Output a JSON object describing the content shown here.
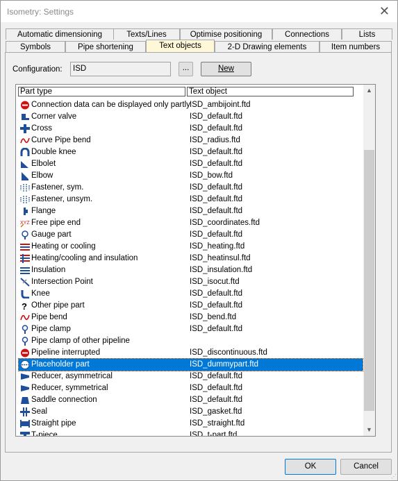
{
  "window": {
    "title": "Isometry: Settings"
  },
  "tabs_back": [
    "Automatic dimensioning",
    "Texts/Lines",
    "Optimise positioning",
    "Connections",
    "Lists"
  ],
  "tabs_front": [
    "Symbols",
    "Pipe shortening",
    "Text objects",
    "2-D Drawing elements",
    "Item numbers"
  ],
  "active_tab": "Text objects",
  "config": {
    "label": "Configuration:",
    "value": "ISD",
    "browse_label": "...",
    "new_label": "New"
  },
  "list": {
    "columns": [
      "Part type",
      "Text object"
    ],
    "rows": [
      {
        "icon": "no-entry-icon",
        "part": "Connection data can be displayed only partly",
        "text": "ISD_ambijoint.ftd"
      },
      {
        "icon": "corner-valve-icon",
        "part": "Corner valve",
        "text": "ISD_default.ftd"
      },
      {
        "icon": "cross-icon",
        "part": "Cross",
        "text": "ISD_default.ftd"
      },
      {
        "icon": "curve-bend-icon",
        "part": "Curve Pipe bend",
        "text": "ISD_radius.ftd"
      },
      {
        "icon": "double-knee-icon",
        "part": "Double knee",
        "text": "ISD_default.ftd"
      },
      {
        "icon": "elbolet-icon",
        "part": "Elbolet",
        "text": "ISD_default.ftd"
      },
      {
        "icon": "elbow-icon",
        "part": "Elbow",
        "text": "ISD_bow.ftd"
      },
      {
        "icon": "fastener-icon",
        "part": "Fastener, sym.",
        "text": "ISD_default.ftd"
      },
      {
        "icon": "fastener-icon",
        "part": "Fastener, unsym.",
        "text": "ISD_default.ftd"
      },
      {
        "icon": "flange-icon",
        "part": "Flange",
        "text": "ISD_default.ftd"
      },
      {
        "icon": "pipe-end-icon",
        "part": "Free pipe end",
        "text": "ISD_coordinates.ftd"
      },
      {
        "icon": "gauge-icon",
        "part": "Gauge part",
        "text": "ISD_default.ftd"
      },
      {
        "icon": "heating-icon",
        "part": "Heating or cooling",
        "text": "ISD_heating.ftd"
      },
      {
        "icon": "heating-insul-icon",
        "part": "Heating/cooling and insulation",
        "text": "ISD_heatinsul.ftd"
      },
      {
        "icon": "insulation-icon",
        "part": "Insulation",
        "text": "ISD_insulation.ftd"
      },
      {
        "icon": "intersection-icon",
        "part": "Intersection Point",
        "text": "ISD_isocut.ftd"
      },
      {
        "icon": "knee-icon",
        "part": "Knee",
        "text": "ISD_default.ftd"
      },
      {
        "icon": "question-icon",
        "part": "Other pipe part",
        "text": "ISD_default.ftd"
      },
      {
        "icon": "pipe-bend-icon",
        "part": "Pipe bend",
        "text": "ISD_bend.ftd"
      },
      {
        "icon": "pipe-clamp-icon",
        "part": "Pipe clamp",
        "text": "ISD_default.ftd"
      },
      {
        "icon": "pipe-clamp-icon",
        "part": "Pipe clamp of other pipeline",
        "text": ""
      },
      {
        "icon": "no-entry-icon",
        "part": "Pipeline interrupted",
        "text": "ISD_discontinuous.ftd"
      },
      {
        "icon": "placeholder-icon",
        "part": "Placeholder part",
        "text": "ISD_dummypart.ftd",
        "selected": true
      },
      {
        "icon": "reducer-icon",
        "part": "Reducer, asymmetrical",
        "text": "ISD_default.ftd"
      },
      {
        "icon": "reducer-icon",
        "part": "Reducer, symmetrical",
        "text": "ISD_default.ftd"
      },
      {
        "icon": "saddle-icon",
        "part": "Saddle connection",
        "text": "ISD_default.ftd"
      },
      {
        "icon": "seal-icon",
        "part": "Seal",
        "text": "ISD_gasket.ftd"
      },
      {
        "icon": "straight-pipe-icon",
        "part": "Straight pipe",
        "text": "ISD_straight.ftd"
      },
      {
        "icon": "tee-icon",
        "part": "T-piece",
        "text": "ISD_t-part.ftd"
      }
    ]
  },
  "buttons": {
    "ok": "OK",
    "cancel": "Cancel"
  },
  "colors": {
    "selection": "#0078d7",
    "active_tab": "#fff8d8",
    "icon_blue": "#1f4f9a",
    "icon_red": "#d01010"
  }
}
